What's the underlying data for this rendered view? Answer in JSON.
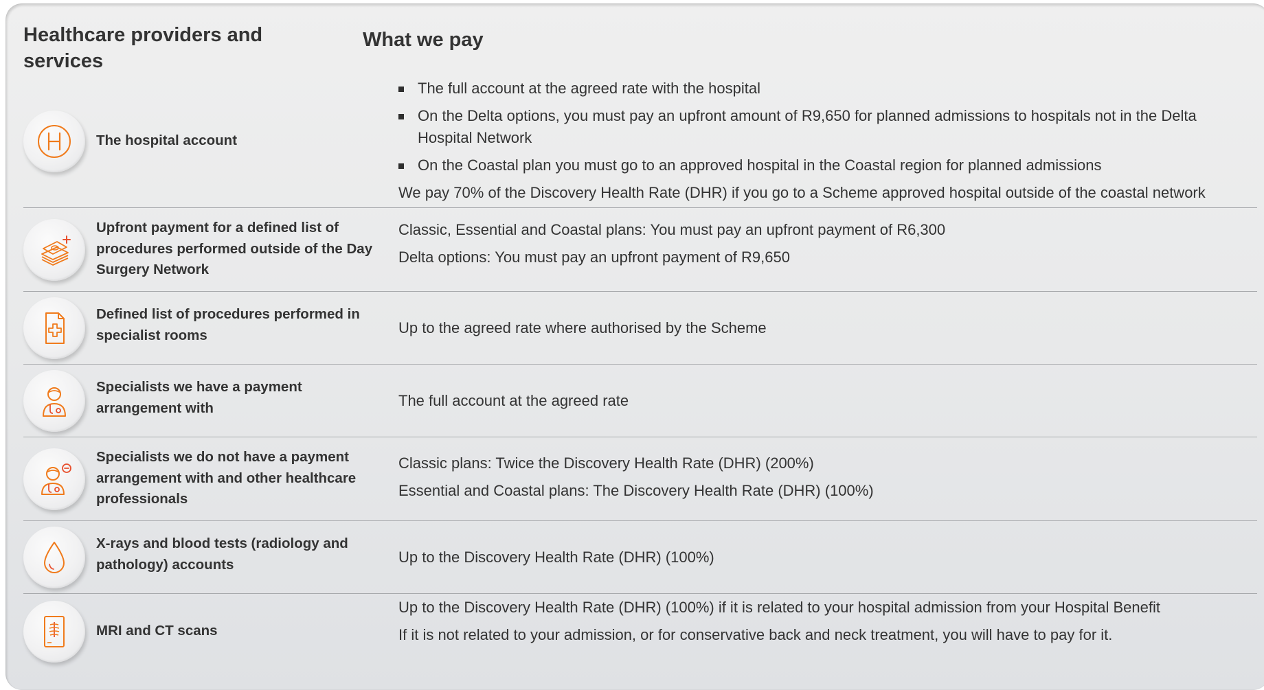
{
  "header": {
    "providers_title": "Healthcare providers and services",
    "pay_title": "What we pay"
  },
  "colors": {
    "icon_accent": "#f07b1c",
    "icon_accent_red": "#e8502e"
  },
  "rows": [
    {
      "label": "The hospital account",
      "icon": "hospital-h-icon",
      "bullets": [
        "The full account at the agreed rate with the hospital",
        "On the Delta options, you must pay an upfront amount of R9,650 for planned admissions to hospitals not in the Delta Hospital Network",
        "On the Coastal plan you must go to an approved hospital in the Coastal region for planned admissions"
      ],
      "note": "We pay 70% of the Discovery Health Rate (DHR) if you go to a Scheme approved hospital outside of the coastal network"
    },
    {
      "label": "Upfront payment for a defined list of procedures performed outside of the Day Surgery Network",
      "icon": "money-stack-icon",
      "lines": [
        "Classic, Essential and Coastal plans: You must pay an upfront payment of R6,300",
        "Delta options: You must pay an upfront payment of R9,650"
      ]
    },
    {
      "label": "Defined list of procedures performed in specialist rooms",
      "icon": "medical-document-icon",
      "lines": [
        "Up to the agreed rate where authorised by the Scheme"
      ]
    },
    {
      "label": "Specialists we have a payment arrangement with",
      "icon": "doctor-icon",
      "lines": [
        "The full account at the agreed rate"
      ]
    },
    {
      "label": "Specialists we do not have a payment arrangement with and other healthcare professionals",
      "icon": "doctor-minus-icon",
      "lines": [
        "Classic plans: Twice the Discovery Health Rate (DHR) (200%)",
        "Essential and Coastal plans: The Discovery Health Rate (DHR) (100%)"
      ]
    },
    {
      "label": "X-rays and blood tests (radiology and pathology) accounts",
      "icon": "blood-drop-icon",
      "lines": [
        "Up to the Discovery Health Rate (DHR) (100%)"
      ]
    },
    {
      "label": "MRI and CT scans",
      "icon": "xray-scan-icon",
      "lines": [
        "Up to the Discovery Health Rate (DHR) (100%) if it is related to your hospital admission from your Hospital Benefit",
        "If it is not related to your admission, or for conservative back and neck treatment, you will have to pay for it."
      ]
    }
  ]
}
